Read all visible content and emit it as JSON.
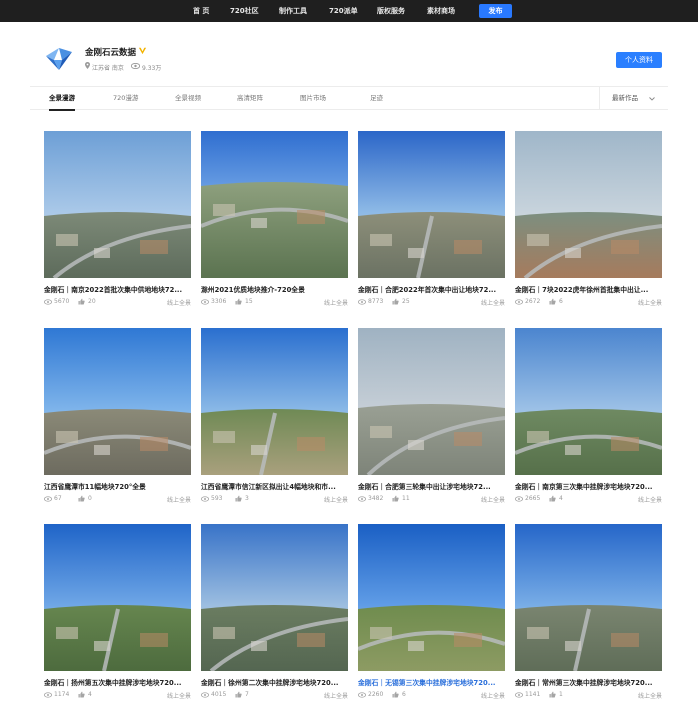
{
  "nav": {
    "items": [
      "首 页",
      "720社区",
      "制作工具",
      "720派单",
      "版权服务",
      "素材商场"
    ],
    "publish": "发布"
  },
  "profile": {
    "name": "金刚石云数据",
    "location": "江苏省 南京",
    "views": "9.33万",
    "button": "个人资料"
  },
  "tabs": {
    "items": [
      "全景漫游",
      "720漫游",
      "全景视频",
      "高清矩阵",
      "图片市场",
      "足迹"
    ],
    "sort": "最新作品"
  },
  "cards": [
    {
      "title": "金刚石｜南京2022首批次集中供地地块72...",
      "views": "5670",
      "likes": "20",
      "tag": "线上全景"
    },
    {
      "title": "滁州2021优质地块推介-720全景",
      "views": "3306",
      "likes": "15",
      "tag": "线上全景"
    },
    {
      "title": "金刚石｜合肥2022年首次集中出让地块72...",
      "views": "8773",
      "likes": "25",
      "tag": "线上全景"
    },
    {
      "title": "金刚石｜7块2022虎年徐州首批集中出让...",
      "views": "2672",
      "likes": "6",
      "tag": "线上全景"
    },
    {
      "title": "江西省鹰潭市11幅地块720°全景",
      "views": "67",
      "likes": "0",
      "tag": "线上全景"
    },
    {
      "title": "江西省鹰潭市信江新区拟出让4幅地块和市...",
      "views": "593",
      "likes": "3",
      "tag": "线上全景"
    },
    {
      "title": "金刚石｜合肥第三轮集中出让涉宅地块72...",
      "views": "3482",
      "likes": "11",
      "tag": "线上全景"
    },
    {
      "title": "金刚石｜南京第三次集中挂牌涉宅地块720...",
      "views": "2665",
      "likes": "4",
      "tag": "线上全景"
    },
    {
      "title": "金刚石｜扬州第五次集中挂牌涉宅地块720...",
      "views": "1174",
      "likes": "4",
      "tag": "线上全景"
    },
    {
      "title": "金刚石｜徐州第二次集中挂牌涉宅地块720...",
      "views": "4015",
      "likes": "7",
      "tag": "线上全景"
    },
    {
      "title": "金刚石｜无锡第三次集中挂牌涉宅地块720...",
      "views": "2260",
      "likes": "6",
      "tag": "线上全景"
    },
    {
      "title": "金刚石｜常州第三次集中挂牌涉宅地块720...",
      "views": "1141",
      "likes": "1",
      "tag": "线上全景"
    }
  ],
  "colors": {
    "accent": "#2a7fff",
    "nav_bg": "#1f1f1f",
    "title_highlight": "#2a6fdb"
  },
  "icons": {
    "location": "location-pin-icon",
    "views": "eye-icon",
    "likes": "thumbs-up-icon",
    "verified": "verified-v-icon",
    "sort": "chevron-down-icon"
  }
}
